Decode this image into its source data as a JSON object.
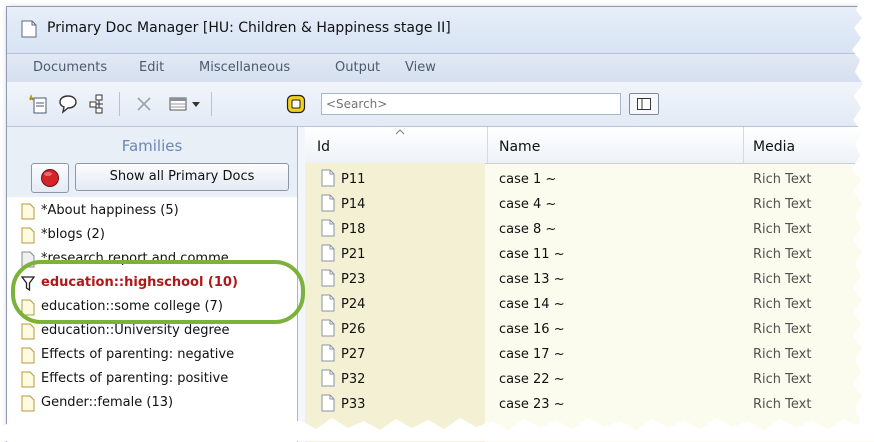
{
  "window": {
    "title": "Primary Doc Manager [HU: Children & Happiness stage II]"
  },
  "menu": [
    "Documents",
    "Edit",
    "Miscellaneous",
    "Output",
    "View"
  ],
  "search": {
    "placeholder": "<Search>"
  },
  "families": {
    "label": "Families",
    "show_all_label": "Show all Primary Docs",
    "items": [
      {
        "label": "*About happiness (5)",
        "active": false
      },
      {
        "label": "*blogs (2)",
        "active": false
      },
      {
        "label": "*research report and comme",
        "active": false
      },
      {
        "label": "education::highschool (10)",
        "active": true
      },
      {
        "label": "education::some college (7)",
        "active": false
      },
      {
        "label": "education::University degree",
        "active": false
      },
      {
        "label": "Effects of parenting: negative",
        "active": false
      },
      {
        "label": "Effects of parenting: positive",
        "active": false
      },
      {
        "label": "Gender::female (13)",
        "active": false
      }
    ]
  },
  "table": {
    "columns": [
      "Id",
      "Name",
      "Media"
    ],
    "rows": [
      {
        "id": "P11",
        "name": "case 1 ~",
        "media": "Rich Text"
      },
      {
        "id": "P14",
        "name": "case 4 ~",
        "media": "Rich Text"
      },
      {
        "id": "P18",
        "name": "case 8 ~",
        "media": "Rich Text"
      },
      {
        "id": "P21",
        "name": "case 11 ~",
        "media": "Rich Text"
      },
      {
        "id": "P23",
        "name": "case 13 ~",
        "media": "Rich Text"
      },
      {
        "id": "P24",
        "name": "case 14 ~",
        "media": "Rich Text"
      },
      {
        "id": "P26",
        "name": "case 16 ~",
        "media": "Rich Text"
      },
      {
        "id": "P27",
        "name": "case 17 ~",
        "media": "Rich Text"
      },
      {
        "id": "P32",
        "name": "case 22 ~",
        "media": "Rich Text"
      },
      {
        "id": "P33",
        "name": "case 23 ~",
        "media": "Rich Text"
      }
    ]
  },
  "colors": {
    "active_family": "#b01818",
    "highlight_ring": "#7cb23a",
    "families_label": "#6a87b7",
    "row_bg": "#fbfbee"
  }
}
